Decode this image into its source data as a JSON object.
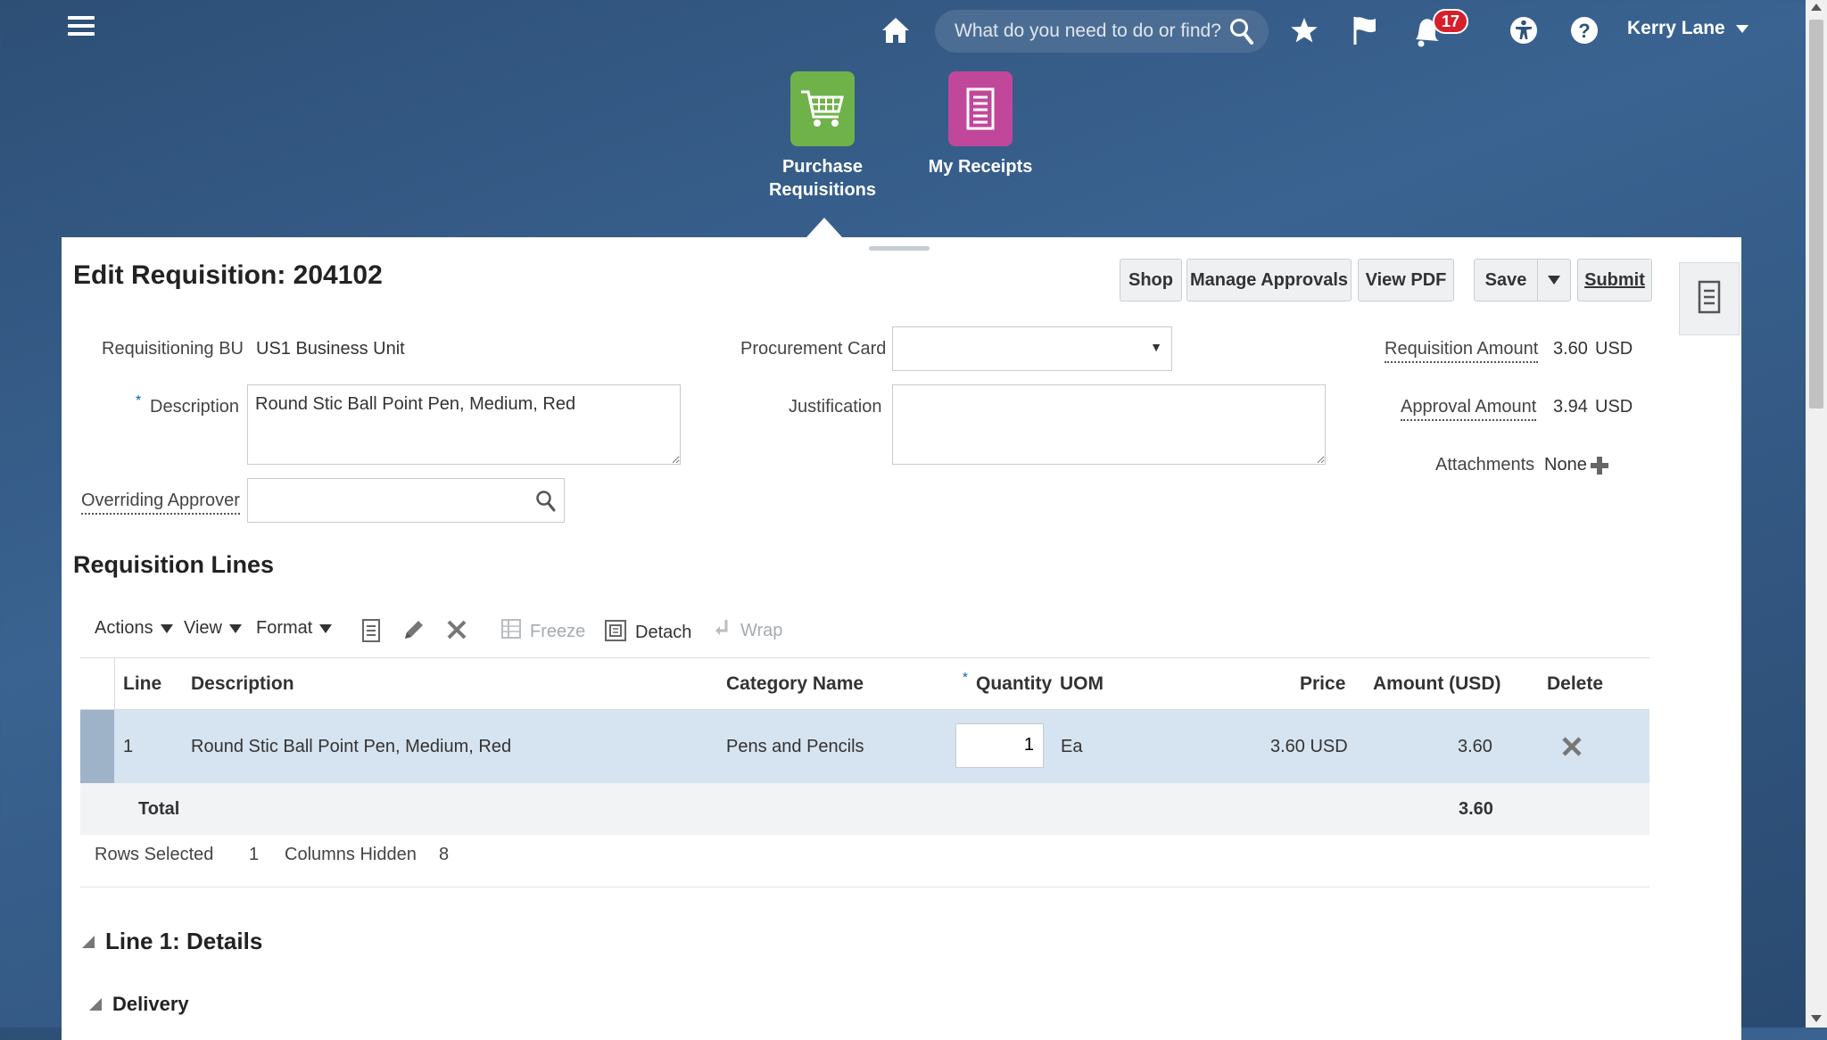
{
  "topbar": {
    "search_placeholder": "What do you need to do or find?",
    "notifications_count": "17",
    "user_name": "Kerry Lane"
  },
  "apps": [
    {
      "label_line1": "Purchase",
      "label_line2": "Requisitions",
      "color": "#6fb24a",
      "icon": "shopping-cart-icon"
    },
    {
      "label_line1": "My Receipts",
      "label_line2": "",
      "color": "#c1479a",
      "icon": "receipt-icon"
    }
  ],
  "page": {
    "title": "Edit Requisition: 204102",
    "buttons": {
      "shop": "Shop",
      "manage_approvals": "Manage Approvals",
      "view_pdf": "View PDF",
      "save": "Save",
      "submit": "Submit"
    }
  },
  "form": {
    "requisitioning_bu_label": "Requisitioning BU",
    "requisitioning_bu_value": "US1 Business Unit",
    "description_required": "*",
    "description_label": "Description",
    "description_value": "Round Stic Ball Point Pen, Medium, Red",
    "overriding_approver_label": "Overriding Approver",
    "overriding_approver_value": "",
    "procurement_card_label": "Procurement Card",
    "procurement_card_value": "",
    "justification_label": "Justification",
    "justification_value": "",
    "requisition_amount_label": "Requisition Amount",
    "requisition_amount_value": "3.60",
    "requisition_amount_currency": "USD",
    "approval_amount_label": "Approval Amount",
    "approval_amount_value": "3.94",
    "approval_amount_currency": "USD",
    "attachments_label": "Attachments",
    "attachments_value": "None"
  },
  "lines": {
    "title": "Requisition Lines",
    "toolbar": {
      "actions": "Actions",
      "view": "View",
      "format": "Format",
      "freeze": "Freeze",
      "detach": "Detach",
      "wrap": "Wrap"
    },
    "columns": {
      "line": "Line",
      "description": "Description",
      "category": "Category Name",
      "quantity_required": "*",
      "quantity": "Quantity",
      "uom": "UOM",
      "price": "Price",
      "amount": "Amount (USD)",
      "delete": "Delete"
    },
    "rows": [
      {
        "line": "1",
        "description": "Round Stic Ball Point Pen, Medium, Red",
        "category": "Pens and Pencils",
        "quantity": "1",
        "uom": "Ea",
        "price": "3.60 USD",
        "amount": "3.60"
      }
    ],
    "total_label": "Total",
    "total_value": "3.60",
    "rows_selected_label": "Rows Selected",
    "rows_selected_value": "1",
    "columns_hidden_label": "Columns Hidden",
    "columns_hidden_value": "8"
  },
  "details": {
    "line_details_title": "Line 1: Details",
    "delivery_title": "Delivery"
  }
}
